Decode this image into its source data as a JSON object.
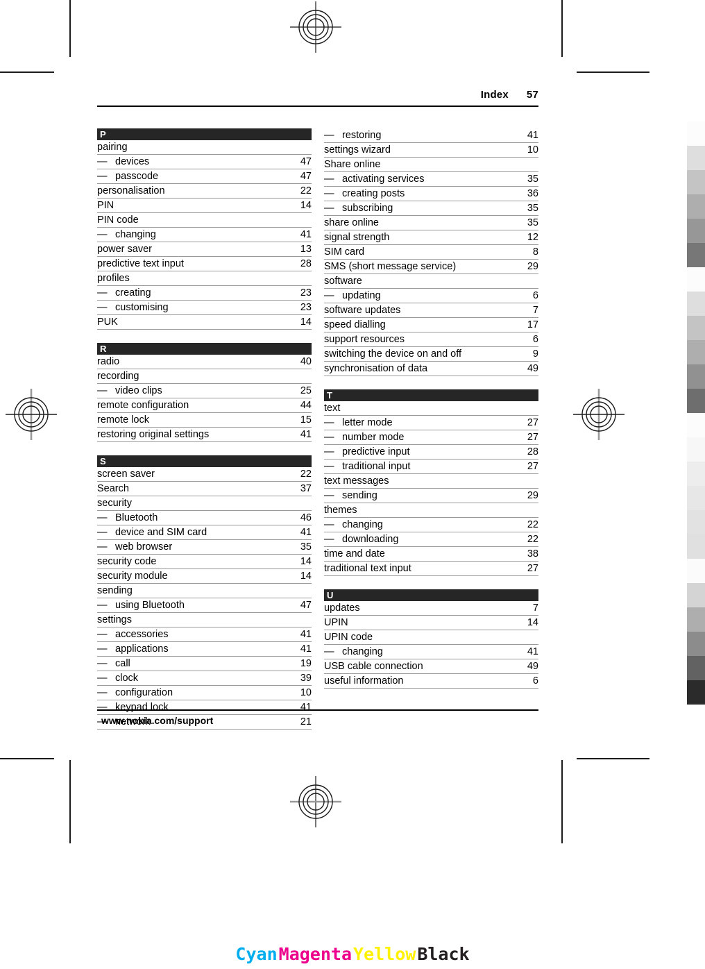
{
  "header": {
    "label": "Index",
    "page_number": "57"
  },
  "footer": {
    "url": "www.nokia.com/support"
  },
  "columns": [
    {
      "sections": [
        {
          "letter": "P",
          "entries": [
            {
              "label": "pairing",
              "page": ""
            },
            {
              "label": "devices",
              "page": "47",
              "sub": true
            },
            {
              "label": "passcode",
              "page": "47",
              "sub": true
            },
            {
              "label": "personalisation",
              "page": "22"
            },
            {
              "label": "PIN",
              "page": "14"
            },
            {
              "label": "PIN code",
              "page": ""
            },
            {
              "label": "changing",
              "page": "41",
              "sub": true
            },
            {
              "label": "power saver",
              "page": "13"
            },
            {
              "label": "predictive text input",
              "page": "28"
            },
            {
              "label": "profiles",
              "page": ""
            },
            {
              "label": "creating",
              "page": "23",
              "sub": true
            },
            {
              "label": "customising",
              "page": "23",
              "sub": true
            },
            {
              "label": "PUK",
              "page": "14"
            }
          ]
        },
        {
          "letter": "R",
          "entries": [
            {
              "label": "radio",
              "page": "40"
            },
            {
              "label": "recording",
              "page": ""
            },
            {
              "label": "video clips",
              "page": "25",
              "sub": true
            },
            {
              "label": "remote configuration",
              "page": "44"
            },
            {
              "label": "remote lock",
              "page": "15"
            },
            {
              "label": "restoring original settings",
              "page": "41"
            }
          ]
        },
        {
          "letter": "S",
          "entries": [
            {
              "label": "screen saver",
              "page": "22"
            },
            {
              "label": "Search",
              "page": "37"
            },
            {
              "label": "security",
              "page": ""
            },
            {
              "label": "Bluetooth",
              "page": "46",
              "sub": true
            },
            {
              "label": "device and SIM card",
              "page": "41",
              "sub": true
            },
            {
              "label": "web browser",
              "page": "35",
              "sub": true
            },
            {
              "label": "security code",
              "page": "14"
            },
            {
              "label": "security module",
              "page": "14"
            },
            {
              "label": "sending",
              "page": ""
            },
            {
              "label": "using Bluetooth",
              "page": "47",
              "sub": true
            },
            {
              "label": "settings",
              "page": ""
            },
            {
              "label": "accessories",
              "page": "41",
              "sub": true
            },
            {
              "label": "applications",
              "page": "41",
              "sub": true
            },
            {
              "label": "call",
              "page": "19",
              "sub": true
            },
            {
              "label": "clock",
              "page": "39",
              "sub": true
            },
            {
              "label": "configuration",
              "page": "10",
              "sub": true
            },
            {
              "label": "keypad lock",
              "page": "41",
              "sub": true
            },
            {
              "label": "network",
              "page": "21",
              "sub": true
            }
          ]
        }
      ]
    },
    {
      "sections": [
        {
          "letter": "",
          "entries": [
            {
              "label": "restoring",
              "page": "41",
              "sub": true
            },
            {
              "label": "settings wizard",
              "page": "10"
            },
            {
              "label": "Share online",
              "page": ""
            },
            {
              "label": "activating services",
              "page": "35",
              "sub": true
            },
            {
              "label": "creating posts",
              "page": "36",
              "sub": true
            },
            {
              "label": "subscribing",
              "page": "35",
              "sub": true
            },
            {
              "label": "share online",
              "page": "35"
            },
            {
              "label": "signal strength",
              "page": "12"
            },
            {
              "label": "SIM card",
              "page": "8"
            },
            {
              "label": "SMS (short message service)",
              "page": "29"
            },
            {
              "label": "software",
              "page": ""
            },
            {
              "label": "updating",
              "page": "6",
              "sub": true
            },
            {
              "label": "software updates",
              "page": "7"
            },
            {
              "label": "speed dialling",
              "page": "17"
            },
            {
              "label": "support resources",
              "page": "6"
            },
            {
              "label": "switching the device on and off",
              "page": "9"
            },
            {
              "label": "synchronisation of data",
              "page": "49"
            }
          ]
        },
        {
          "letter": "T",
          "entries": [
            {
              "label": "text",
              "page": ""
            },
            {
              "label": "letter mode",
              "page": "27",
              "sub": true
            },
            {
              "label": "number mode",
              "page": "27",
              "sub": true
            },
            {
              "label": "predictive input",
              "page": "28",
              "sub": true
            },
            {
              "label": "traditional input",
              "page": "27",
              "sub": true
            },
            {
              "label": "text messages",
              "page": ""
            },
            {
              "label": "sending",
              "page": "29",
              "sub": true
            },
            {
              "label": "themes",
              "page": ""
            },
            {
              "label": "changing",
              "page": "22",
              "sub": true
            },
            {
              "label": "downloading",
              "page": "22",
              "sub": true
            },
            {
              "label": "time and date",
              "page": "38"
            },
            {
              "label": "traditional text input",
              "page": "27"
            }
          ]
        },
        {
          "letter": "U",
          "entries": [
            {
              "label": "updates",
              "page": "7"
            },
            {
              "label": "UPIN",
              "page": "14"
            },
            {
              "label": "UPIN code",
              "page": ""
            },
            {
              "label": "changing",
              "page": "41",
              "sub": true
            },
            {
              "label": "USB cable connection",
              "page": "49"
            },
            {
              "label": "useful information",
              "page": "6"
            }
          ]
        }
      ]
    }
  ],
  "dash": "—",
  "grayscale_strip": {
    "values": [
      "#fcfcfc",
      "#dedede",
      "#c4c4c4",
      "#aeaeae",
      "#979797",
      "#777777",
      "#fcfcfc",
      "#dedede",
      "#c4c4c4",
      "#aeaeae",
      "#919191",
      "#6e6e6e",
      "#fcfcfc",
      "#f7f7f7",
      "#ededed",
      "#e7e7e7",
      "#e2e2e2",
      "#e0e0e0",
      "#fbfbfb",
      "#d4d4d4",
      "#aeaeae",
      "#8c8c8c",
      "#626262",
      "#2b2b2b"
    ]
  },
  "cmyk_bar": {
    "items": [
      {
        "text": "Cyan",
        "color": "#00aeef"
      },
      {
        "text": "Magenta",
        "color": "#ec008c"
      },
      {
        "text": "Yellow",
        "color": "#fff200"
      },
      {
        "text": "Black",
        "color": "#231f20"
      }
    ]
  }
}
